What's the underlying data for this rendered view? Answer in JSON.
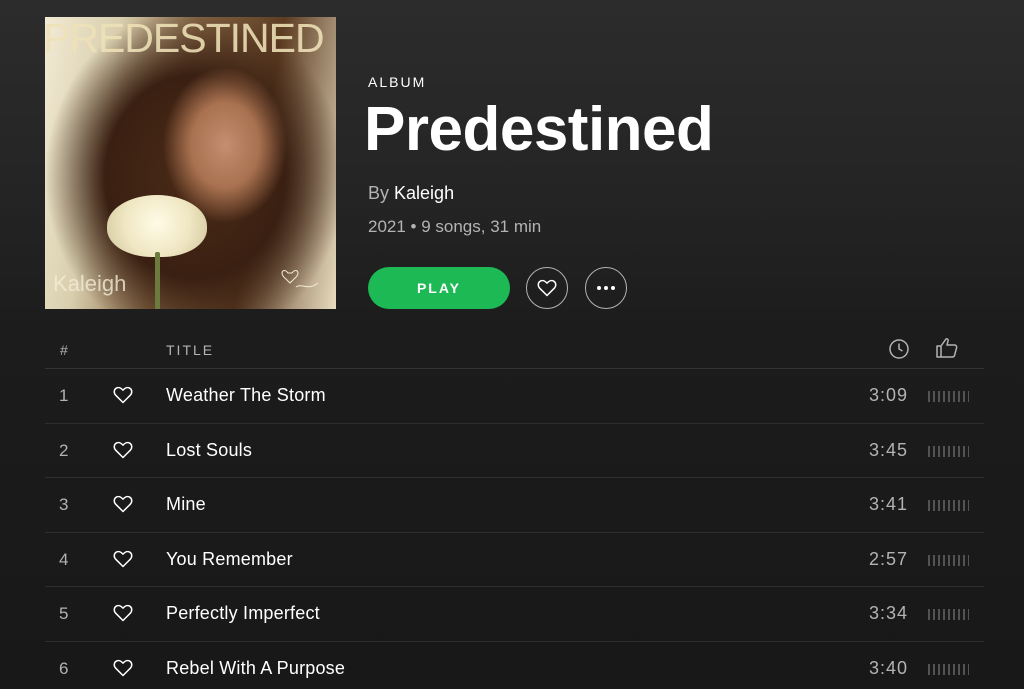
{
  "cover": {
    "title_text": "PREDESTINED",
    "artist_text": "Kaleigh"
  },
  "album": {
    "type": "ALBUM",
    "title": "Predestined",
    "by_prefix": "By",
    "artist": "Kaleigh",
    "meta": "2021 • 9 songs, 31 min"
  },
  "actions": {
    "play_label": "PLAY",
    "like_icon": "heart-icon",
    "more_icon": "more-icon"
  },
  "tracklist": {
    "header": {
      "number": "#",
      "title": "TITLE",
      "duration_icon": "clock-icon",
      "popularity_icon": "thumbs-up-icon"
    },
    "tracks": [
      {
        "number": "1",
        "title": "Weather The Storm",
        "duration": "3:09"
      },
      {
        "number": "2",
        "title": "Lost Souls",
        "duration": "3:45"
      },
      {
        "number": "3",
        "title": "Mine",
        "duration": "3:41"
      },
      {
        "number": "4",
        "title": "You Remember",
        "duration": "2:57"
      },
      {
        "number": "5",
        "title": "Perfectly Imperfect",
        "duration": "3:34"
      },
      {
        "number": "6",
        "title": "Rebel With A Purpose",
        "duration": "3:40"
      }
    ]
  },
  "colors": {
    "accent": "#1db954",
    "background": "#181818",
    "muted_text": "#b3b3b3"
  }
}
